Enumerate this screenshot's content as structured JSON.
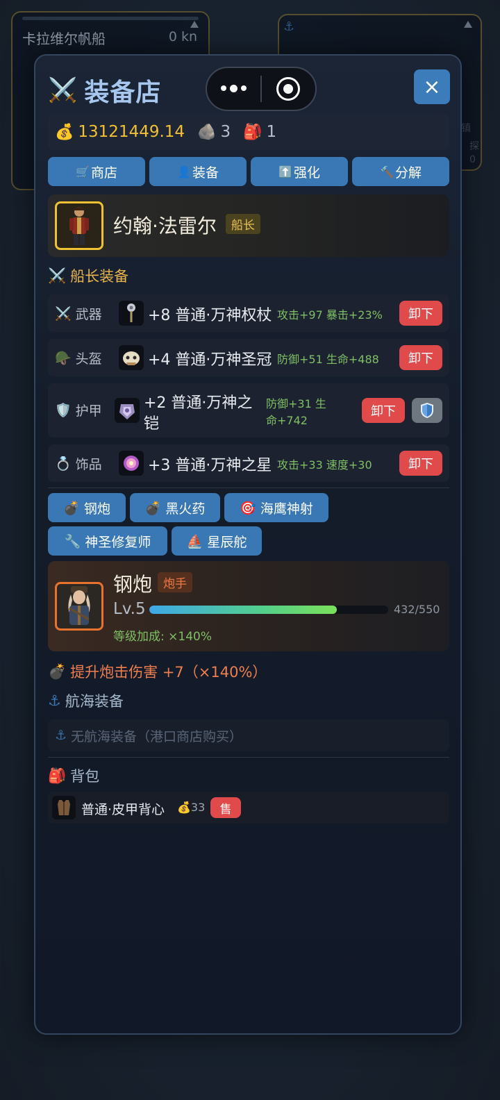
{
  "background": {
    "ship_panel": {
      "title": "卡拉维尔帆船",
      "speed": "0 kn"
    },
    "right_panel": {
      "hint_1": "镇",
      "hint_2": "探",
      "hint_3": "0"
    }
  },
  "header": {
    "title_icon": "crossed-swords-icon",
    "title": "装备店",
    "close_label": "×"
  },
  "resources": {
    "gold": "13121449.14",
    "ore": "3",
    "bag": "1"
  },
  "tabs": [
    {
      "icon": "cart-icon",
      "label": "商店"
    },
    {
      "icon": "person-icon",
      "label": "装备"
    },
    {
      "icon": "arrow-up-icon",
      "label": "强化"
    },
    {
      "icon": "hammer-icon",
      "label": "分解"
    }
  ],
  "captain": {
    "name": "约翰·法雷尔",
    "role": "船长"
  },
  "captain_equipment": {
    "section_title": "船长装备",
    "rows": [
      {
        "slot": "武器",
        "item": "+8 普通·万神权杖",
        "stats": "攻击+97 暴击+23%",
        "action": "卸下"
      },
      {
        "slot": "头盔",
        "item": "+4 普通·万神圣冠",
        "stats": "防御+51 生命+488",
        "action": "卸下"
      },
      {
        "slot": "护甲",
        "item_line1": "+2 普通·万神之",
        "item_line2": "铠",
        "stats_line1": "防御+31 生",
        "stats_line2": "命+742",
        "action": "卸下"
      },
      {
        "slot": "饰品",
        "item": "+3 普通·万神之星",
        "stats": "攻击+33 速度+30",
        "action": "卸下"
      }
    ]
  },
  "crew_tabs": [
    {
      "icon": "bomb-icon",
      "label": "钢炮"
    },
    {
      "icon": "bomb-icon",
      "label": "黑火药"
    },
    {
      "icon": "target-icon",
      "label": "海鹰神射"
    },
    {
      "icon": "wrench-icon",
      "label": "神圣修复师"
    },
    {
      "icon": "sailboat-icon",
      "label": "星辰舵"
    }
  ],
  "crew_member": {
    "name": "钢炮",
    "role": "炮手",
    "level": "Lv.5",
    "xp_text": "432/550",
    "xp_fraction": 0.785,
    "bonus": "等级加成: ×140%"
  },
  "effect": "提升炮击伤害 +7（×140%）",
  "sailing_equipment": {
    "section_title": "航海装备",
    "empty_text": "无航海装备（港口商店购买）"
  },
  "backpack": {
    "section_title": "背包",
    "items": [
      {
        "name": "普通·皮甲背心",
        "price": "33",
        "sell_label": "售"
      }
    ]
  },
  "colors": {
    "accent_blue": "#3a78b5",
    "danger_red": "#e04a4a",
    "gold": "#f3c033",
    "stat_green": "#7fbf65"
  }
}
